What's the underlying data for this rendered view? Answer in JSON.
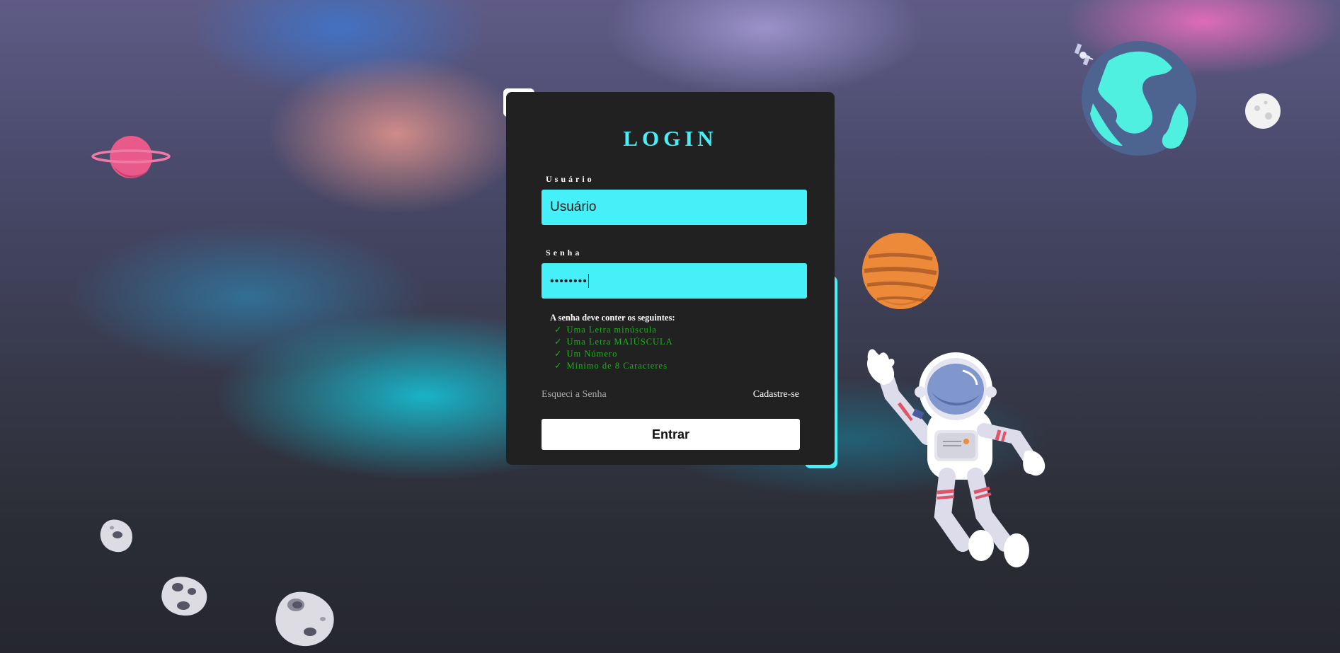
{
  "login": {
    "title": "LOGIN",
    "username_label": "Usuário",
    "username_value": "Usuário",
    "password_label": "Senha",
    "password_value": "••••••••",
    "rules_title": "A senha deve conter os seguintes:",
    "rules": [
      "Uma Letra minúscula",
      "Uma Letra MAIÚSCULA",
      "Um Número",
      "Mínimo de 8 Caracteres"
    ],
    "check_glyph": "✓",
    "forgot_label": "Esqueci a Senha",
    "signup_label": "Cadastre-se",
    "submit_label": "Entrar"
  },
  "colors": {
    "accent": "#46f0f9",
    "card": "#212121",
    "rule_ok": "#1cb21c"
  },
  "decorations": [
    "ringed-planet-icon",
    "earth-icon",
    "satellite-icon",
    "moon-icon",
    "jupiter-icon",
    "astronaut-icon",
    "asteroid-icon"
  ]
}
